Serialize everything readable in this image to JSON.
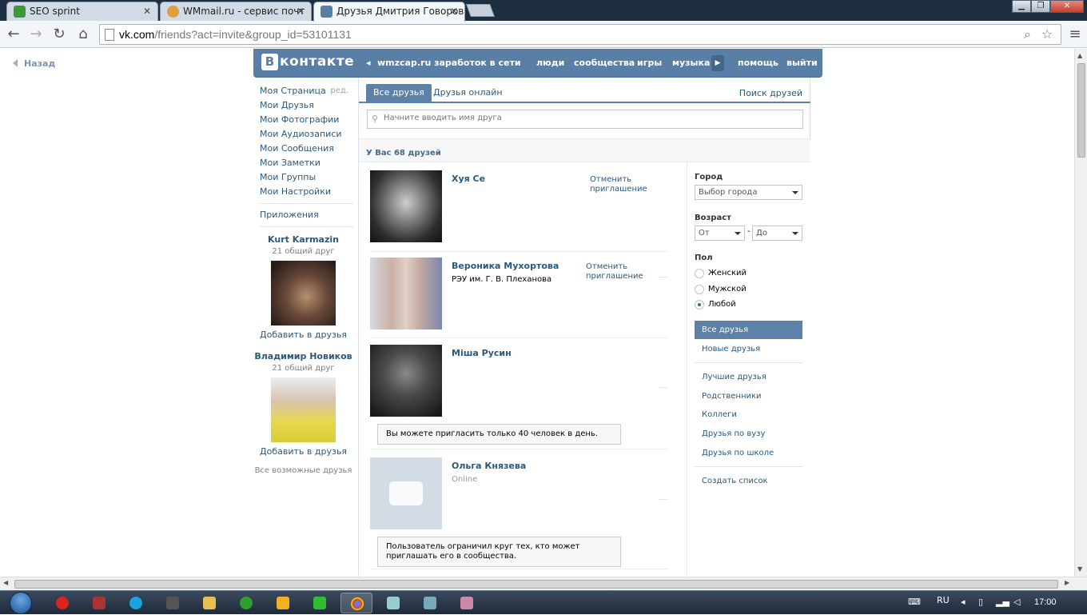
{
  "browser": {
    "tabs": [
      {
        "title": "SEO sprint",
        "favicon_color": "#3a9a3a"
      },
      {
        "title": "WMmail.ru - сервис почт",
        "favicon_color": "#e0a040"
      },
      {
        "title": "Друзья Дмитрия Говоров",
        "favicon_color": "#5a7fa6"
      }
    ],
    "url_host": "vk.com",
    "url_path": "/friends?act=invite&group_id=53101131"
  },
  "page": {
    "back_label": "Назад",
    "header": {
      "logo_letter": "В",
      "logo_text": "контакте",
      "ad_link": "wmzcap.ru заработок в сети инте...",
      "nav": [
        "люди",
        "сообщества",
        "игры",
        "музыка",
        "помощь",
        "выйти"
      ]
    },
    "left_menu": {
      "items": [
        "Моя Страница",
        "Мои Друзья",
        "Мои Фотографии",
        "Мои Аудиозаписи",
        "Мои Сообщения",
        "Мои Заметки",
        "Мои Группы",
        "Мои Настройки"
      ],
      "edit_label": "ред.",
      "apps_label": "Приложения",
      "suggestions": [
        {
          "name": "Kurt Karmazin",
          "mutual": "21 общий друг",
          "add": "Добавить в друзья"
        },
        {
          "name": "Владимир Новиков",
          "mutual": "21 общий друг",
          "add": "Добавить в друзья"
        }
      ],
      "all_possible": "Все возможные друзья"
    },
    "tabs": {
      "all": "Все друзья",
      "online": "Друзья онлайн",
      "find": "Поиск друзей"
    },
    "search_placeholder": "Начните вводить имя друга",
    "count_text": "У Вас 68 друзей",
    "friends": [
      {
        "name": "Хуя Се",
        "sub": "",
        "action": "Отменить приглашение"
      },
      {
        "name": "Вероника Мухортова",
        "sub": "РЭУ им. Г. В. Плеханова",
        "action": "Отменить приглашение"
      },
      {
        "name": "Міша Русин",
        "sub": "",
        "notice": "Вы можете пригласить только 40 человек в день."
      },
      {
        "name": "Ольга Князева",
        "sub": "Online",
        "notice": "Пользователь ограничил круг тех, кто может приглашать его в сообщества."
      }
    ],
    "filters": {
      "city_label": "Город",
      "city_value": "Выбор города",
      "age_label": "Возраст",
      "age_from": "От",
      "age_dash": "-",
      "age_to": "До",
      "sex_label": "Пол",
      "sex_options": [
        "Женский",
        "Мужской",
        "Любой"
      ],
      "sex_selected": "Любой",
      "sections": [
        "Все друзья",
        "Новые друзья",
        "Лучшие друзья",
        "Родственники",
        "Коллеги",
        "Друзья по вузу",
        "Друзья по школе",
        "Создать список"
      ]
    }
  },
  "taskbar": {
    "lang": "RU",
    "time": "17:00"
  },
  "colors": {
    "vk_blue": "#5a7fa6",
    "link": "#2b587a",
    "chrome_frame": "#1c2e40"
  }
}
